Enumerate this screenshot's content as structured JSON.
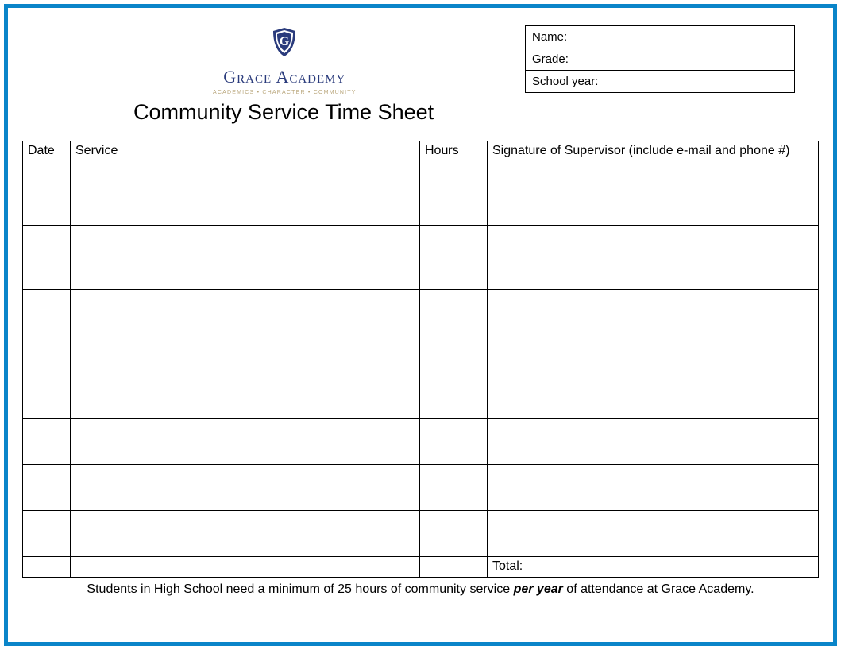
{
  "school": {
    "name": "Grace Academy",
    "tagline_1": "Academics",
    "tagline_2": "Character",
    "tagline_3": "Community"
  },
  "info": {
    "name_label": "Name:",
    "grade_label": "Grade:",
    "year_label": "School year:"
  },
  "title": "Community Service Time Sheet",
  "table": {
    "headers": {
      "date": "Date",
      "service": "Service",
      "hours": "Hours",
      "signature": "Signature of Supervisor (include e-mail and phone #)"
    },
    "total_label": "Total:"
  },
  "footnote": {
    "part1": "Students in High School need a minimum of 25 hours of community service ",
    "emph": "per year",
    "part2": " of attendance at Grace Academy."
  }
}
